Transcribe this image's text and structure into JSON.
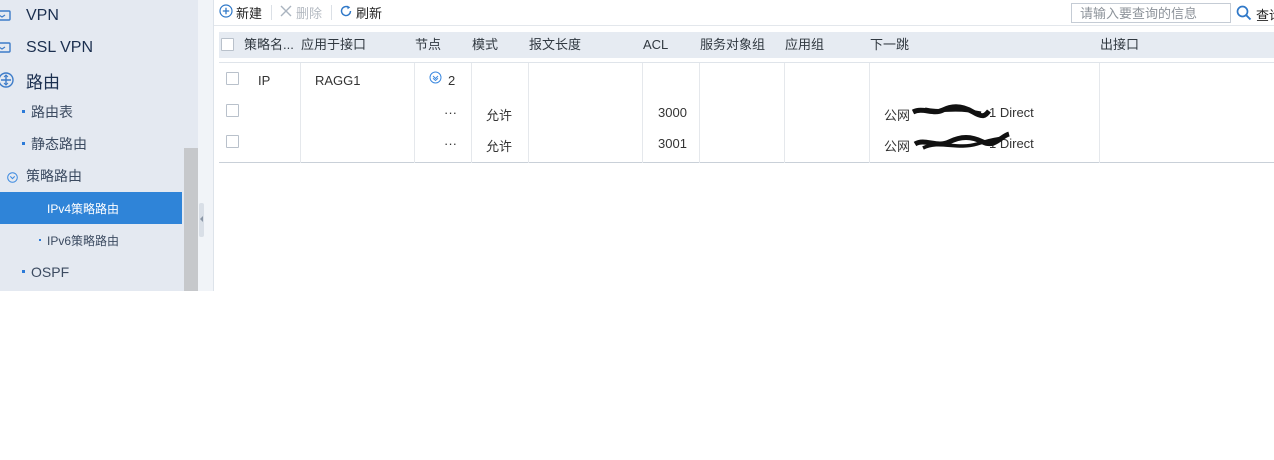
{
  "sidebar": {
    "items": [
      {
        "label": "VPN",
        "icon": "vpn-icon"
      },
      {
        "label": "SSL VPN",
        "icon": "ssl-vpn-icon"
      },
      {
        "label": "路由",
        "icon": "route-icon"
      },
      {
        "label": "路由表"
      },
      {
        "label": "静态路由"
      },
      {
        "label": "策略路由",
        "icon": "chevron-down-icon"
      },
      {
        "label": "IPv4策略路由"
      },
      {
        "label": "IPv6策略路由"
      },
      {
        "label": "OSPF"
      }
    ],
    "accent_color": "#2f84d8"
  },
  "toolbar": {
    "new_label": "新建",
    "delete_label": "删除",
    "refresh_label": "刷新",
    "search_placeholder": "请输入要查询的信息",
    "search_label": "查询"
  },
  "table": {
    "columns": [
      "策略名...",
      "应用于接口",
      "节点",
      "模式",
      "报文长度",
      "ACL",
      "服务对象组",
      "应用组",
      "下一跳",
      "出接口"
    ],
    "group_row": {
      "name": "IP",
      "interface": "RAGG1",
      "node_count": "2"
    },
    "rows": [
      {
        "node": "···",
        "mode": "允许",
        "acl": "3000",
        "next_hop_prefix": "公网",
        "next_hop_suffix": "1 Direct"
      },
      {
        "node": "···",
        "mode": "允许",
        "acl": "3001",
        "next_hop_prefix": "公网",
        "next_hop_suffix": "1 Direct"
      }
    ]
  }
}
